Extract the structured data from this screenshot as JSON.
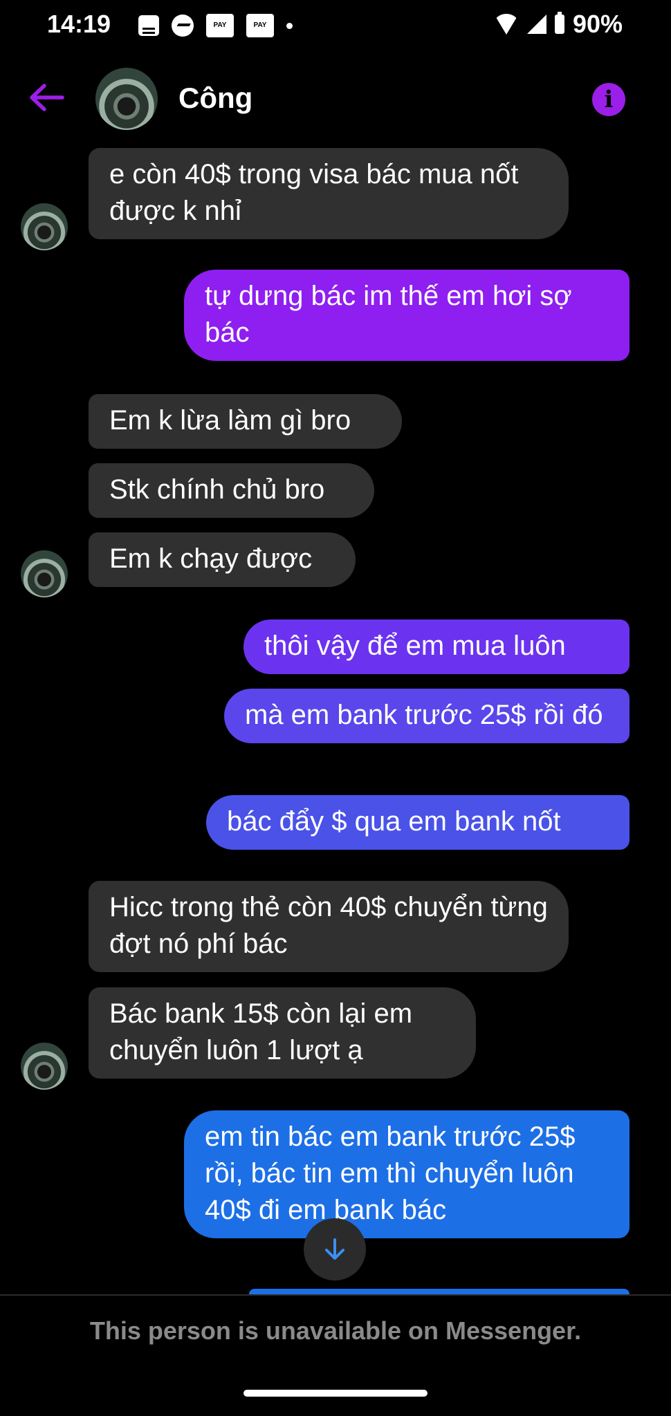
{
  "status_bar": {
    "time": "14:19",
    "pay_label": "PAY",
    "battery": "90%"
  },
  "header": {
    "contact_name": "Công",
    "info_glyph": "i"
  },
  "colors": {
    "accent": "#9b1fe8",
    "incoming_bubble": "#303030",
    "outgoing_purple": "#8e1ff0",
    "outgoing_indigo": "#5a46ea",
    "outgoing_blue": "#1d6fe6"
  },
  "messages": [
    {
      "sender": "Công",
      "text": "e còn 40$ trong visa bác mua nốt được k nhỉ"
    },
    {
      "sender": "me",
      "text": "tự dưng bác im thế em hơi sợ bác"
    },
    {
      "sender": "Công",
      "text": "Em k lừa làm gì bro"
    },
    {
      "sender": "Công",
      "text": "Stk chính chủ bro"
    },
    {
      "sender": "Công",
      "text": "Em k chạy được"
    },
    {
      "sender": "me",
      "text": "thôi vậy để em mua luôn"
    },
    {
      "sender": "me",
      "text": "mà em bank trước 25$ rồi đó"
    },
    {
      "sender": "me",
      "text": "bác đẩy $ qua em bank nốt"
    },
    {
      "sender": "Công",
      "text": "Hicc trong thẻ còn 40$ chuyển từng đợt nó phí bác"
    },
    {
      "sender": "Công",
      "text": "Bác bank 15$ còn lại em chuyển luôn 1 lượt ạ"
    },
    {
      "sender": "me",
      "text": "em tin bác em bank trước 25$ rồi, bác tin em thì chuyển luôn 40$ đi em bank bác"
    }
  ],
  "footer": {
    "notice": "This person is unavailable on Messenger."
  }
}
